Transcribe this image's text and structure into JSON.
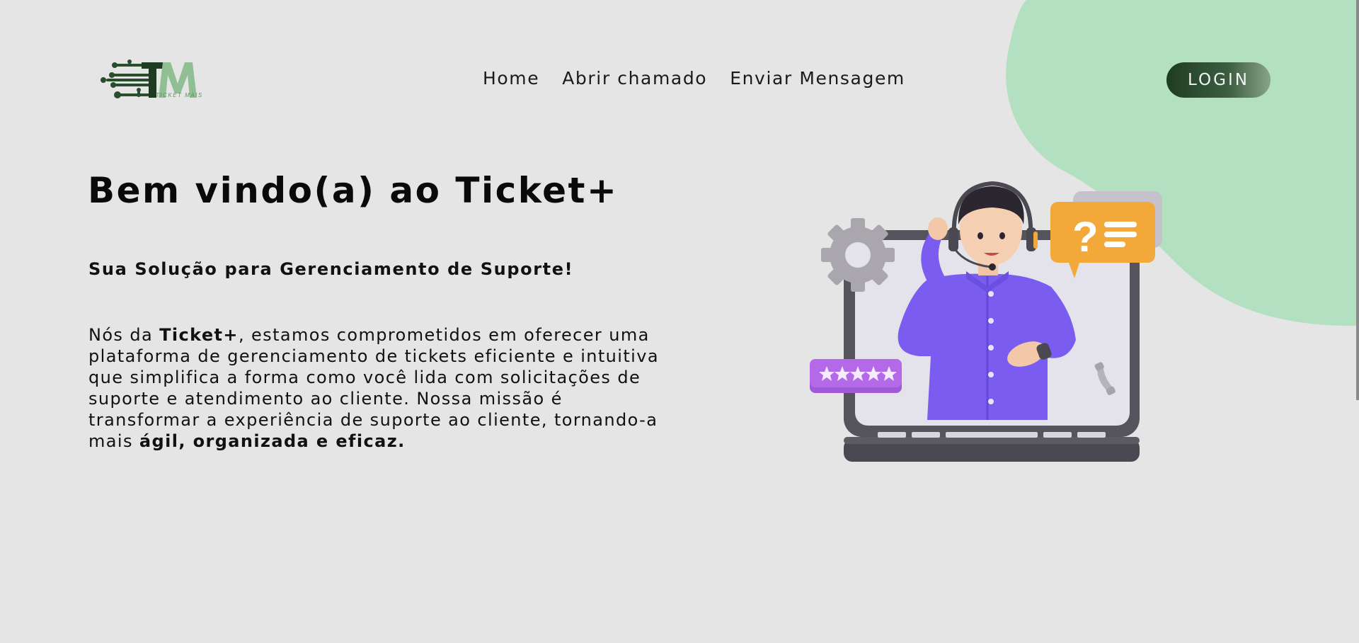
{
  "brand": {
    "logo_letters": "TM",
    "logo_caption": "TICKET MAIS"
  },
  "nav": {
    "items": [
      {
        "label": "Home"
      },
      {
        "label": "Abrir chamado"
      },
      {
        "label": "Enviar Mensagem"
      }
    ],
    "login_label": "LOGIN"
  },
  "hero": {
    "title": "Bem vindo(a) ao Ticket+",
    "subtitle": "Sua Solução para Gerenciamento de Suporte!",
    "body_prefix": "Nós da ",
    "body_brand": "Ticket+",
    "body_main": ", estamos comprometidos em oferecer uma plataforma de gerenciamento de tickets eficiente e intuitiva que simplifica a forma como você lida com solicitações de suporte e atendimento ao cliente. Nossa missão é transformar a experiência de suporte ao cliente, tornando-a mais ",
    "body_emphasis": "ágil, organizada e eficaz."
  },
  "colors": {
    "background": "#e5e5e5",
    "accent_blob": "#b2e0c0",
    "brand_dark_green": "#1e3c22",
    "brand_light_green": "#8fbf93"
  },
  "illustration": {
    "icons": [
      "gear-icon",
      "question-chat-icon",
      "stars-rating-icon",
      "phone-icon",
      "support-agent-icon",
      "laptop-icon"
    ],
    "rating_stars": 5
  }
}
